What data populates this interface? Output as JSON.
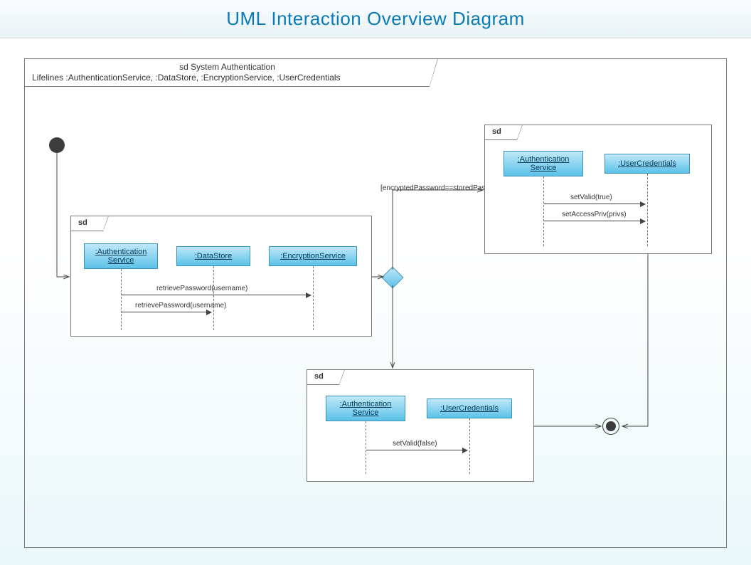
{
  "title": "UML Interaction Overview Diagram",
  "frame": {
    "header_line1": "sd System Authentication",
    "header_line2": "Lifelines :AuthenticationService, :DataStore, :EncryptionService, :UserCredentials"
  },
  "sd_label": "sd",
  "guard_true": "[encryptedPassword==storedPassword]",
  "sd1": {
    "lifelines": {
      "auth": ":Authentication\nService",
      "datastore": ":DataStore",
      "enc": ":EncryptionService"
    },
    "msg1": "retrievePassword(username)",
    "msg2": "retrievePassword(username)"
  },
  "sd2": {
    "lifelines": {
      "auth": ":Authentication\nService",
      "uc": ":UserCredentials"
    },
    "msg1": "setValid(true)",
    "msg2": "setAccessPriv(privs)"
  },
  "sd3": {
    "lifelines": {
      "auth": ":Authentication\nService",
      "uc": ":UserCredentials"
    },
    "msg1": "setValid(false)"
  }
}
